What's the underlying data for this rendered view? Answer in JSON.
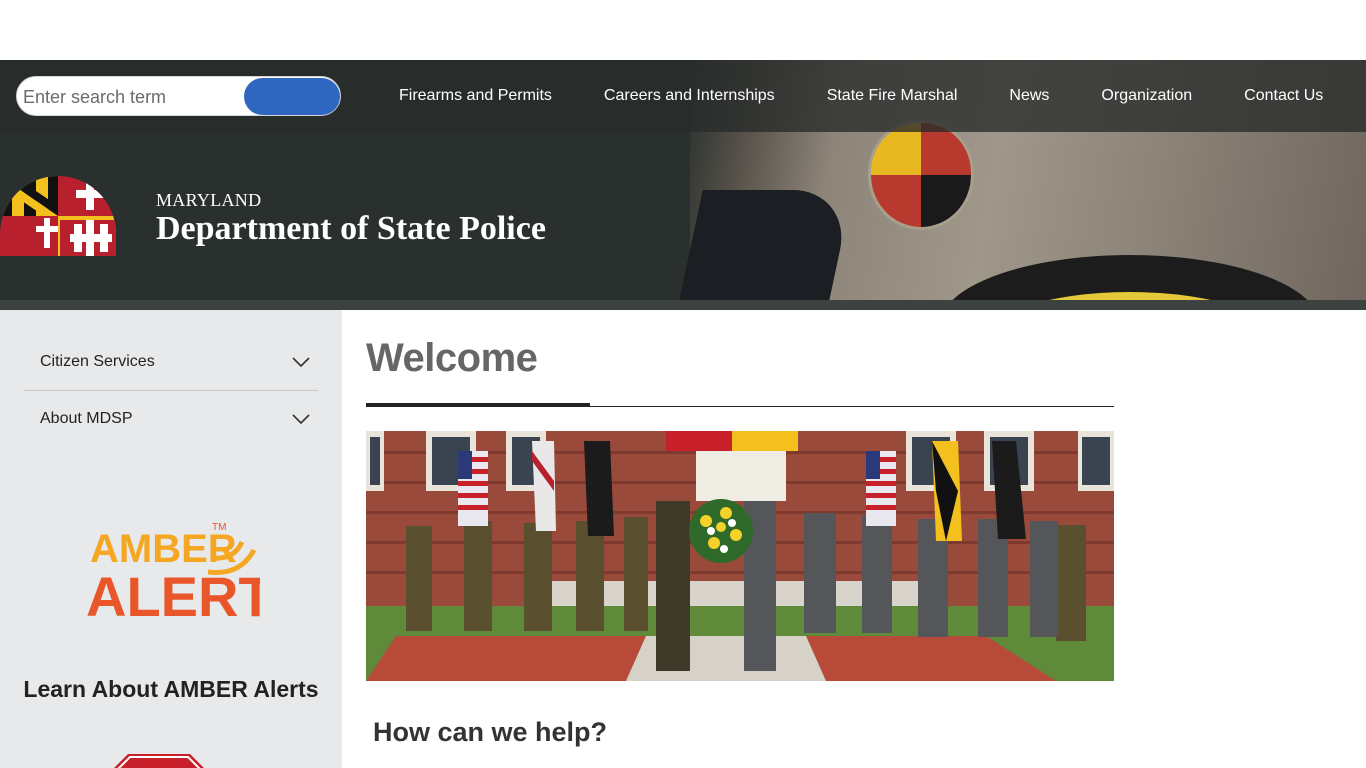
{
  "search": {
    "placeholder": "Enter search term",
    "button_label": ""
  },
  "nav": {
    "items": [
      {
        "label": "Firearms and Permits"
      },
      {
        "label": "Careers and Internships"
      },
      {
        "label": "State Fire Marshal"
      },
      {
        "label": "News"
      },
      {
        "label": "Organization"
      },
      {
        "label": "Contact Us"
      }
    ]
  },
  "brand": {
    "state": "MARYLAND",
    "name": "Department of State Police"
  },
  "sidebar": {
    "items": [
      {
        "label": "Citizen Services",
        "icon": "chevron-down-icon"
      },
      {
        "label": "About MDSP",
        "icon": "chevron-down-icon"
      }
    ],
    "amber": {
      "line1": "AMBER",
      "line2": "ALERT",
      "tm": "TM",
      "heading": "Learn About AMBER Alerts"
    }
  },
  "main": {
    "title": "Welcome",
    "subheading": "How can we help?"
  },
  "colors": {
    "nav_bg": "#2a302d",
    "search_button": "#2e66c0",
    "sidebar_bg": "#e8e9eb",
    "amber_orange": "#e8562a",
    "amber_yellow": "#f5a623"
  }
}
